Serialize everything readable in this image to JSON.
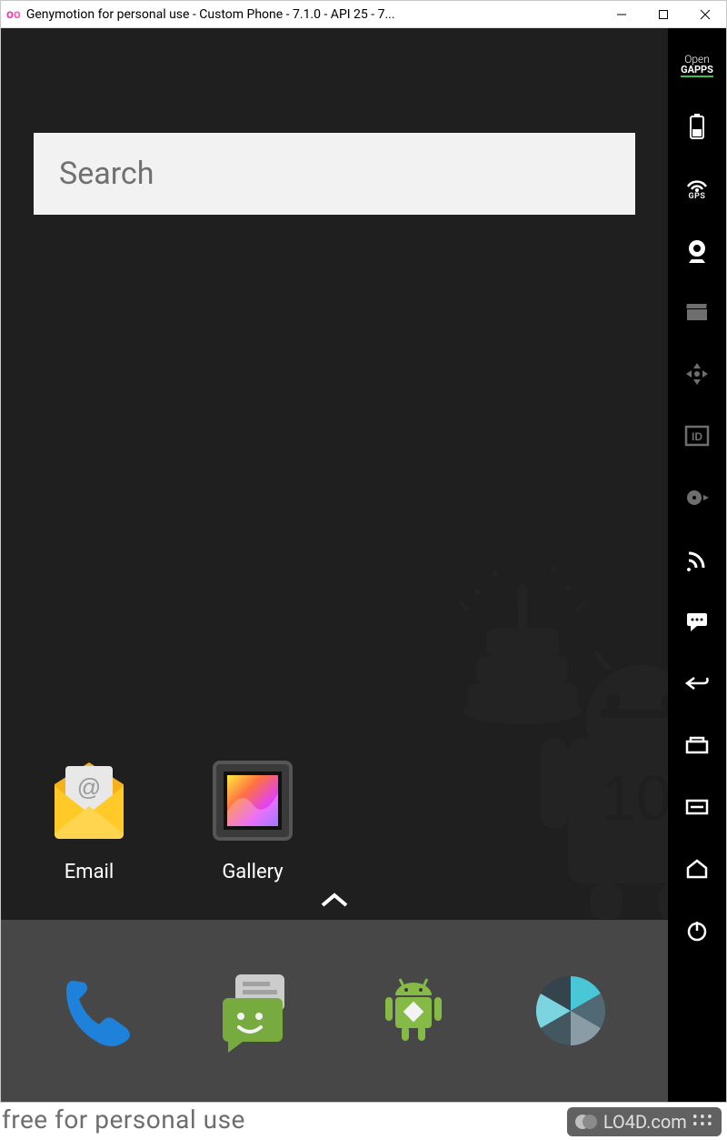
{
  "window": {
    "title": "Genymotion for personal use - Custom Phone - 7.1.0 - API 25 - 7..."
  },
  "search": {
    "placeholder": "Search"
  },
  "apps": [
    {
      "name": "Email"
    },
    {
      "name": "Gallery"
    }
  ],
  "dock": [
    {
      "name": "Phone"
    },
    {
      "name": "Messages"
    },
    {
      "name": "Apps"
    },
    {
      "name": "Camera"
    }
  ],
  "sidebar": {
    "opengapps_l1": "Open",
    "opengapps_l2": "GAPPS",
    "gps_label": "GPS",
    "id_label": "ID"
  },
  "wallpaper": {
    "badge": "10"
  },
  "watermark": "free for personal use",
  "brand": "LO4D.com"
}
